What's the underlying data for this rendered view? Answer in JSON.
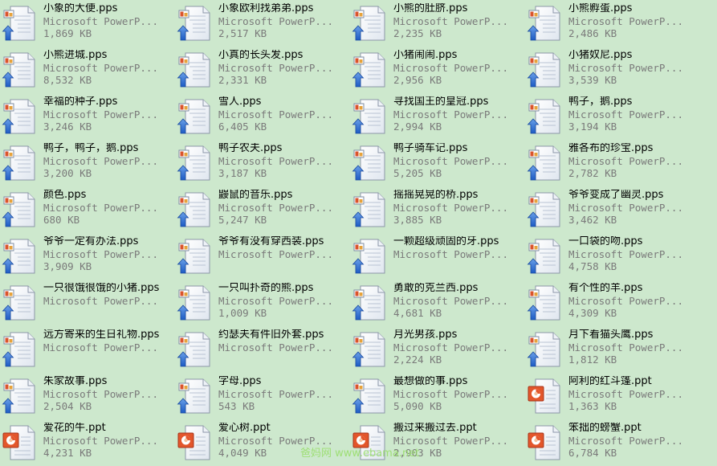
{
  "window": {
    "view": "Tiles",
    "background_color": "#cde8cd"
  },
  "icon_types": {
    "pps": "powerpoint-show-icon",
    "ppt": "powerpoint-presentation-icon"
  },
  "files": [
    {
      "name": "小象的大便.pps",
      "type": "Microsoft PowerP...",
      "size": "1,869 KB",
      "icon": "pps"
    },
    {
      "name": "小象欧利找弟弟.pps",
      "type": "Microsoft PowerP...",
      "size": "2,517 KB",
      "icon": "pps"
    },
    {
      "name": "小熊的肚脐.pps",
      "type": "Microsoft PowerP...",
      "size": "2,235 KB",
      "icon": "pps"
    },
    {
      "name": "小熊孵蛋.pps",
      "type": "Microsoft PowerP...",
      "size": "2,486 KB",
      "icon": "pps"
    },
    {
      "name": "小熊进城.pps",
      "type": "Microsoft PowerP...",
      "size": "8,532 KB",
      "icon": "pps"
    },
    {
      "name": "小真的长头发.pps",
      "type": "Microsoft PowerP...",
      "size": "2,331 KB",
      "icon": "pps"
    },
    {
      "name": "小猪闹闹.pps",
      "type": "Microsoft PowerP...",
      "size": "2,956 KB",
      "icon": "pps"
    },
    {
      "name": "小猪奴尼.pps",
      "type": "Microsoft PowerP...",
      "size": "3,539 KB",
      "icon": "pps"
    },
    {
      "name": "幸福的种子.pps",
      "type": "Microsoft PowerP...",
      "size": "3,246 KB",
      "icon": "pps"
    },
    {
      "name": "雪人.pps",
      "type": "Microsoft PowerP...",
      "size": "6,405 KB",
      "icon": "pps"
    },
    {
      "name": "寻找国王的皇冠.pps",
      "type": "Microsoft PowerP...",
      "size": "2,994 KB",
      "icon": "pps"
    },
    {
      "name": "鸭子，鹅.pps",
      "type": "Microsoft PowerP...",
      "size": "3,194 KB",
      "icon": "pps"
    },
    {
      "name": "鸭子，鸭子，鹅.pps",
      "type": "Microsoft PowerP...",
      "size": "3,200 KB",
      "icon": "pps"
    },
    {
      "name": "鸭子农夫.pps",
      "type": "Microsoft PowerP...",
      "size": "3,187 KB",
      "icon": "pps"
    },
    {
      "name": "鸭子骑车记.pps",
      "type": "Microsoft PowerP...",
      "size": "5,205 KB",
      "icon": "pps"
    },
    {
      "name": "雅各布的珍宝.pps",
      "type": "Microsoft PowerP...",
      "size": "2,782 KB",
      "icon": "pps"
    },
    {
      "name": "颜色.pps",
      "type": "Microsoft PowerP...",
      "size": "680 KB",
      "icon": "pps"
    },
    {
      "name": "鼹鼠的音乐.pps",
      "type": "Microsoft PowerP...",
      "size": "5,247 KB",
      "icon": "pps"
    },
    {
      "name": "摇摇晃晃的桥.pps",
      "type": "Microsoft PowerP...",
      "size": "3,885 KB",
      "icon": "pps"
    },
    {
      "name": "爷爷变成了幽灵.pps",
      "type": "Microsoft PowerP...",
      "size": "3,462 KB",
      "icon": "pps"
    },
    {
      "name": "爷爷一定有办法.pps",
      "type": "Microsoft PowerP...",
      "size": "3,909 KB",
      "icon": "pps"
    },
    {
      "name": "爷爷有没有穿西装.pps",
      "type": "Microsoft PowerP...",
      "size": "",
      "icon": "pps"
    },
    {
      "name": "一颗超级顽固的牙.pps",
      "type": "Microsoft PowerP...",
      "size": "",
      "icon": "pps"
    },
    {
      "name": "一口袋的吻.pps",
      "type": "Microsoft PowerP...",
      "size": "4,758 KB",
      "icon": "pps"
    },
    {
      "name": "一只很饿很饿的小猪.pps",
      "type": "Microsoft PowerP...",
      "size": "",
      "icon": "pps"
    },
    {
      "name": "一只叫扑奇的熊.pps",
      "type": "Microsoft PowerP...",
      "size": "1,009 KB",
      "icon": "pps"
    },
    {
      "name": "勇敢的克兰西.pps",
      "type": "Microsoft PowerP...",
      "size": "4,681 KB",
      "icon": "pps"
    },
    {
      "name": "有个性的羊.pps",
      "type": "Microsoft PowerP...",
      "size": "4,309 KB",
      "icon": "pps"
    },
    {
      "name": "远方寄来的生日礼物.pps",
      "type": "Microsoft PowerP...",
      "size": "",
      "icon": "pps"
    },
    {
      "name": "约瑟夫有件旧外套.pps",
      "type": "Microsoft PowerP...",
      "size": "",
      "icon": "pps"
    },
    {
      "name": "月光男孩.pps",
      "type": "Microsoft PowerP...",
      "size": "2,224 KB",
      "icon": "pps"
    },
    {
      "name": "月下看猫头鹰.pps",
      "type": "Microsoft PowerP...",
      "size": "1,812 KB",
      "icon": "pps"
    },
    {
      "name": "朱家故事.pps",
      "type": "Microsoft PowerP...",
      "size": "2,504 KB",
      "icon": "pps"
    },
    {
      "name": "字母.pps",
      "type": "Microsoft PowerP...",
      "size": "543 KB",
      "icon": "pps"
    },
    {
      "name": "最想做的事.pps",
      "type": "Microsoft PowerP...",
      "size": "5,090 KB",
      "icon": "pps"
    },
    {
      "name": "阿利的红斗篷.ppt",
      "type": "Microsoft PowerP...",
      "size": "1,363 KB",
      "icon": "ppt"
    },
    {
      "name": "爱花的牛.ppt",
      "type": "Microsoft PowerP...",
      "size": "4,231 KB",
      "icon": "ppt"
    },
    {
      "name": "爱心树.ppt",
      "type": "Microsoft PowerP...",
      "size": "4,049 KB",
      "icon": "ppt"
    },
    {
      "name": "搬过来搬过去.ppt",
      "type": "Microsoft PowerP...",
      "size": "2,903 KB",
      "icon": "ppt"
    },
    {
      "name": "笨拙的螃蟹.ppt",
      "type": "Microsoft PowerP...",
      "size": "6,784 KB",
      "icon": "ppt"
    }
  ],
  "watermark": "爸妈网 www.ebama.net"
}
